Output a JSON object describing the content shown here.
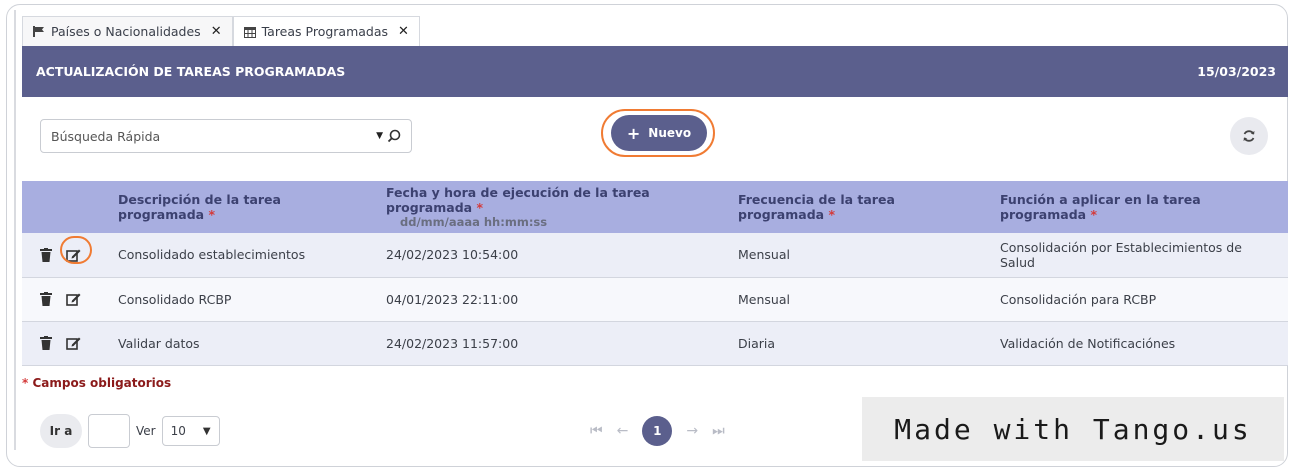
{
  "tabs": [
    {
      "label": "Países o Nacionalidades",
      "icon": "flag-icon"
    },
    {
      "label": "Tareas Programadas",
      "icon": "calendar-icon"
    }
  ],
  "header": {
    "title": "ACTUALIZACIÓN DE TAREAS PROGRAMADAS",
    "date": "15/03/2023"
  },
  "search": {
    "label": "Búsqueda Rápida"
  },
  "new_button": {
    "label": "Nuevo"
  },
  "table": {
    "headers": {
      "description": "Descripción de la tarea programada",
      "datetime": "Fecha y hora de ejecución de la tarea programada",
      "datetime_format": "dd/mm/aaaa hh:mm:ss",
      "frequency": "Frecuencia de la tarea programada",
      "function": "Función a aplicar en la tarea programada",
      "required_mark": "*"
    },
    "rows": [
      {
        "description": "Consolidado establecimientos",
        "datetime": "24/02/2023 10:54:00",
        "frequency": "Mensual",
        "function": "Consolidación por Establecimientos de Salud"
      },
      {
        "description": "Consolidado RCBP",
        "datetime": "04/01/2023 22:11:00",
        "frequency": "Mensual",
        "function": "Consolidación para RCBP"
      },
      {
        "description": "Validar datos",
        "datetime": "24/02/2023 11:57:00",
        "frequency": "Diaria",
        "function": "Validación de Notificaciónes"
      }
    ]
  },
  "required_note": {
    "asterisk": "*",
    "text": "Campos obligatorios"
  },
  "pager": {
    "goto_label": "Ir a",
    "ver_label": "Ver",
    "page_size": "10",
    "current_page": "1"
  },
  "watermark": "Made with Tango.us",
  "colors": {
    "header_bg": "#5b5f8d",
    "table_header_bg": "#a8aee0",
    "highlight": "#f07b33",
    "required": "#d43a3a"
  }
}
